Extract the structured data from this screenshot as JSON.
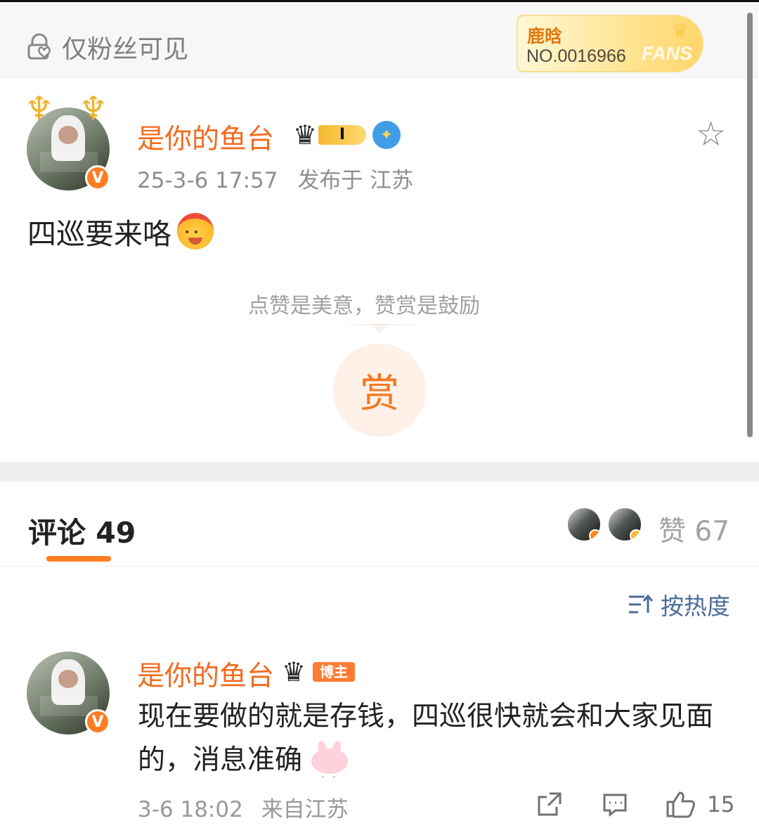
{
  "header": {
    "visibility_label": "仅粉丝可见",
    "fans_badge": {
      "name": "鹿晗",
      "number": "NO.0016966",
      "label": "FANS"
    }
  },
  "post": {
    "author": "是你的鱼台",
    "rank": "I",
    "timestamp": "25-3-6 17:57",
    "location": "发布于 江苏",
    "text": "四巡要来咯",
    "reward_hint": "点赞是美意，赞赏是鼓励",
    "reward_button": "赏"
  },
  "comments": {
    "title": "评论 49",
    "likes": "赞 67",
    "sort_label": "按热度",
    "items": [
      {
        "author": "是你的鱼台",
        "role_badge": "博主",
        "text": "现在要做的就是存钱，四巡很快就会和大家见面的，消息准确",
        "time": "3-6 18:02",
        "location": "来自江苏",
        "like_count": "15"
      }
    ]
  },
  "colors": {
    "accent": "#ff7d22",
    "username": "#f36b1e",
    "sort_blue": "#4b6b99"
  },
  "icons": [
    "lock-heart-icon",
    "star-icon",
    "crown-icon",
    "verify-icon",
    "share-icon",
    "comment-icon",
    "thumb-up-icon",
    "sort-icon"
  ]
}
